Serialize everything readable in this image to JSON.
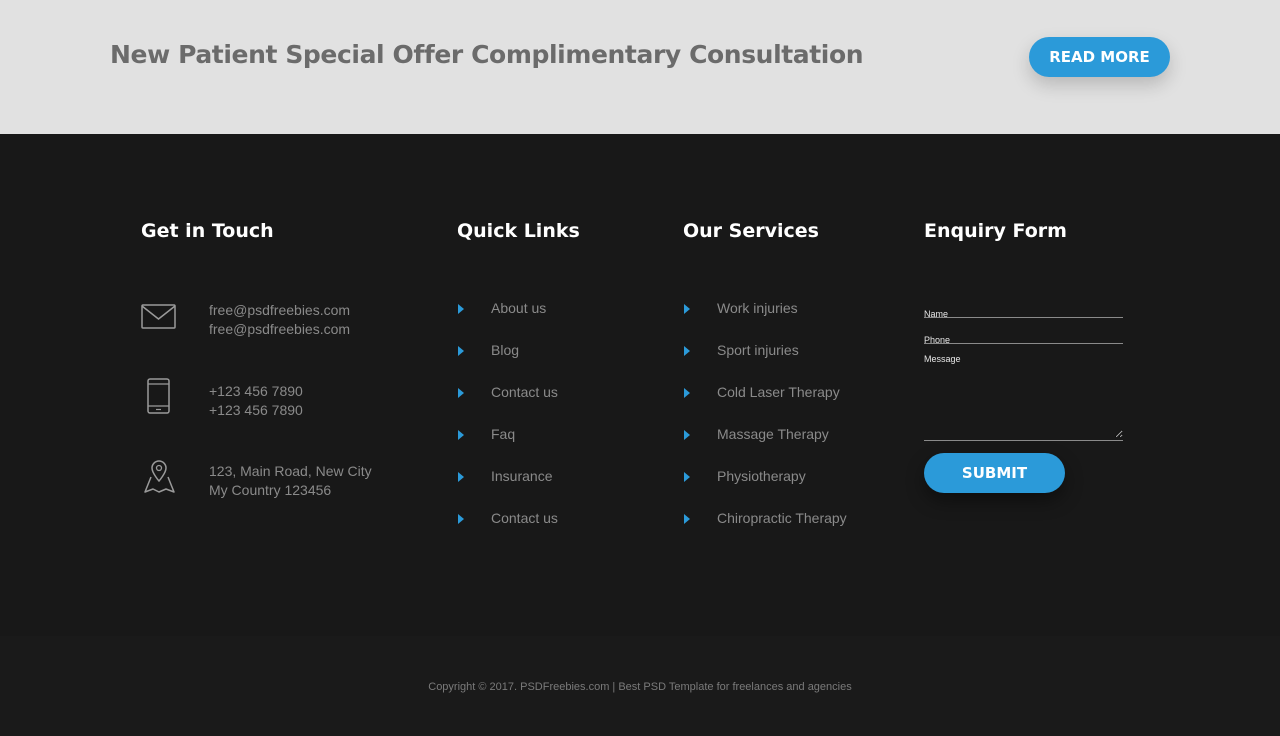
{
  "promo": {
    "title": "New Patient Special Offer Complimentary Consultation",
    "button_label": "READ MORE"
  },
  "footer": {
    "get_in_touch": {
      "title": "Get in Touch",
      "email": {
        "icon": "envelope-icon",
        "line1": "free@psdfreebies.com",
        "line2": "free@psdfreebies.com"
      },
      "phone": {
        "icon": "mobile-phone-icon",
        "line1": "+123 456 7890",
        "line2": "+123 456 7890"
      },
      "address": {
        "icon": "map-pin-icon",
        "line1": "123, Main Road, New City",
        "line2": "My Country 123456"
      }
    },
    "quick_links": {
      "title": "Quick Links",
      "items": [
        {
          "label": "About us"
        },
        {
          "label": "Blog"
        },
        {
          "label": "Contact us"
        },
        {
          "label": "Faq"
        },
        {
          "label": "Insurance"
        },
        {
          "label": "Contact us"
        }
      ]
    },
    "services": {
      "title": "Our Services",
      "items": [
        {
          "label": "Work injuries"
        },
        {
          "label": "Sport injuries"
        },
        {
          "label": "Cold Laser Therapy"
        },
        {
          "label": "Massage Therapy"
        },
        {
          "label": "Physiotherapy"
        },
        {
          "label": "Chiropractic Therapy"
        }
      ]
    },
    "enquiry": {
      "title": "Enquiry Form",
      "name_placeholder": "Name",
      "phone_placeholder": "Phone",
      "message_placeholder": "Message",
      "submit_label": "SUBMIT"
    }
  },
  "copyright": "Copyright © 2017. PSDFreebies.com | Best PSD Template for freelances and agencies",
  "colors": {
    "accent": "#2b9ad9",
    "footer_bg": "#181818",
    "promo_bg": "#e1e1e1"
  }
}
